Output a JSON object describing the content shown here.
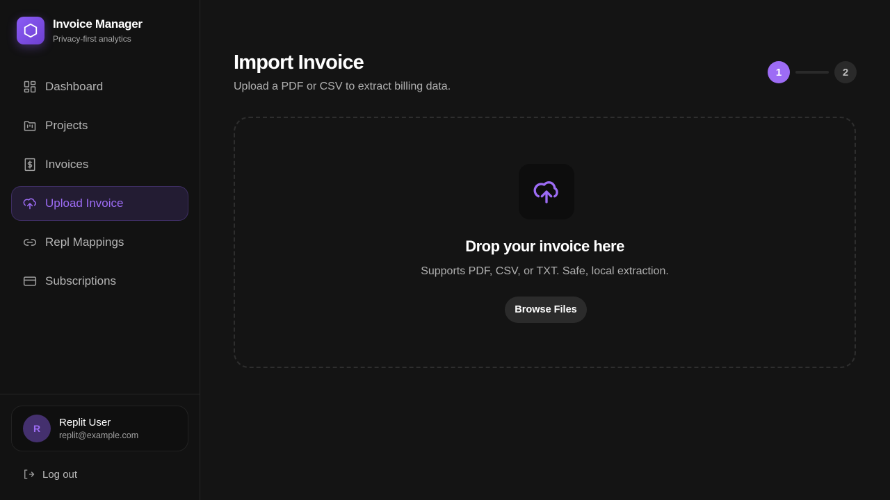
{
  "brand": {
    "title": "Invoice Manager",
    "subtitle": "Privacy-first analytics",
    "icon": "hexagon-icon"
  },
  "nav": [
    {
      "label": "Dashboard",
      "icon": "dashboard-icon"
    },
    {
      "label": "Projects",
      "icon": "folder-icon"
    },
    {
      "label": "Invoices",
      "icon": "receipt-icon"
    },
    {
      "label": "Upload Invoice",
      "icon": "cloud-upload-icon",
      "active": true
    },
    {
      "label": "Repl Mappings",
      "icon": "link-icon"
    },
    {
      "label": "Subscriptions",
      "icon": "credit-card-icon"
    }
  ],
  "user": {
    "initial": "R",
    "name": "Replit User",
    "email": "replit@example.com"
  },
  "logout": "Log out",
  "page": {
    "title": "Import Invoice",
    "subtitle": "Upload a PDF or CSV to extract billing data."
  },
  "steps": [
    "1",
    "2"
  ],
  "dropzone": {
    "title": "Drop your invoice here",
    "subtitle": "Supports PDF, CSV, or TXT. Safe, local extraction.",
    "button": "Browse Files"
  },
  "colors": {
    "accent": "#9d6cf5",
    "background": "#141414"
  }
}
